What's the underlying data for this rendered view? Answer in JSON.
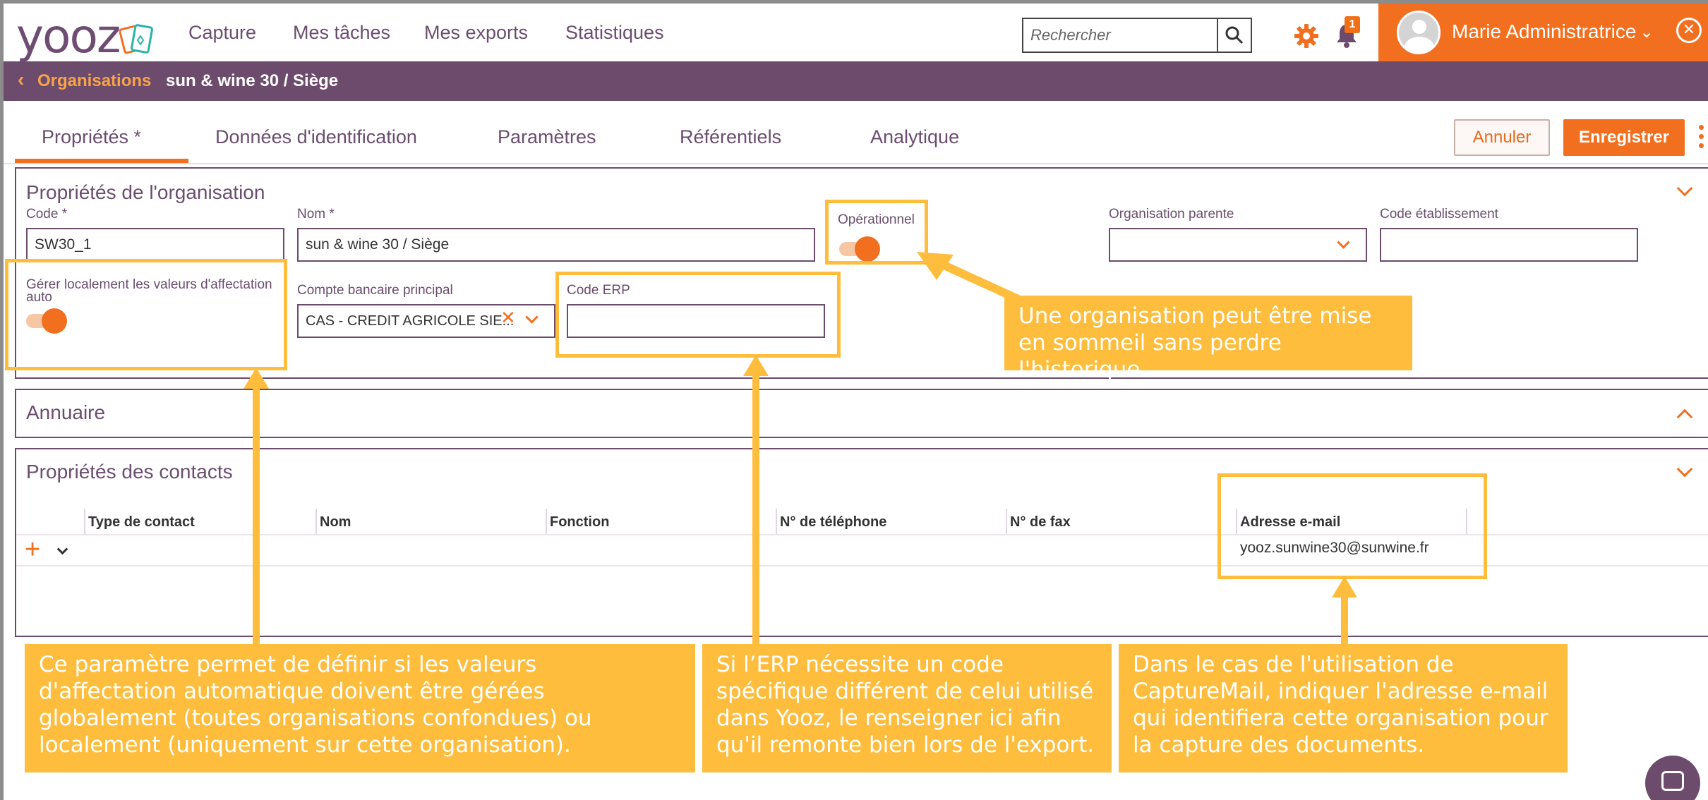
{
  "brand": {
    "logo_text": "yooz"
  },
  "nav": {
    "items": [
      "Capture",
      "Mes tâches",
      "Mes exports",
      "Statistiques"
    ]
  },
  "search": {
    "placeholder": "Rechercher",
    "icon": "search-icon"
  },
  "notifications": {
    "count": "1"
  },
  "user": {
    "name": "Marie Administratrice"
  },
  "colors": {
    "accent": "#f26f1f",
    "brand_purple": "#6c4b6c",
    "annotation": "#ffbd3d"
  },
  "breadcrumb": {
    "back_label": "Organisations",
    "current": "sun & wine 30 / Siège"
  },
  "tabs": [
    {
      "label": "Propriétés *",
      "active": true
    },
    {
      "label": "Données d'identification"
    },
    {
      "label": "Paramètres"
    },
    {
      "label": "Référentiels"
    },
    {
      "label": "Analytique"
    }
  ],
  "actions": {
    "cancel": "Annuler",
    "save": "Enregistrer"
  },
  "org_properties": {
    "title": "Propriétés de l'organisation",
    "code_label": "Code *",
    "code_value": "SW30_1",
    "name_label": "Nom *",
    "name_value": "sun & wine 30 / Siège",
    "operational_label": "Opérationnel",
    "operational_on": true,
    "parent_label": "Organisation parente",
    "parent_value": "",
    "establishment_label": "Code établissement",
    "establishment_value": "",
    "local_affect_label": "Gérer localement les valeurs d'affectation auto",
    "local_affect_on": true,
    "bank_label": "Compte bancaire principal",
    "bank_value": "CAS - CREDIT AGRICOLE SIE...",
    "erp_label": "Code ERP",
    "erp_value": ""
  },
  "directory": {
    "title": "Annuaire"
  },
  "contacts": {
    "title": "Propriétés des contacts",
    "columns": [
      "Type de contact",
      "Nom",
      "Fonction",
      "N° de téléphone",
      "N° de fax",
      "Adresse e-mail"
    ],
    "rows": [
      {
        "type": "",
        "name": "",
        "function": "",
        "phone": "",
        "fax": "",
        "email": "yooz.sunwine30@sunwine.fr"
      }
    ]
  },
  "annotations": {
    "operational": "Une organisation peut être mise en sommeil sans perdre l'historique.",
    "local_affect": "Ce paramètre permet de définir si les valeurs d'affectation automatique doivent être gérées globalement (toutes organisations confondues) ou localement (uniquement sur cette organisation).",
    "erp": "Si l’ERP nécessite un code spécifique différent de celui utilisé dans Yooz, le renseigner ici afin qu'il remonte bien lors de l'export.",
    "email": "Dans le cas de l'utilisation de CaptureMail, indiquer l'adresse e-mail qui identifiera cette organisation pour la capture des documents."
  }
}
